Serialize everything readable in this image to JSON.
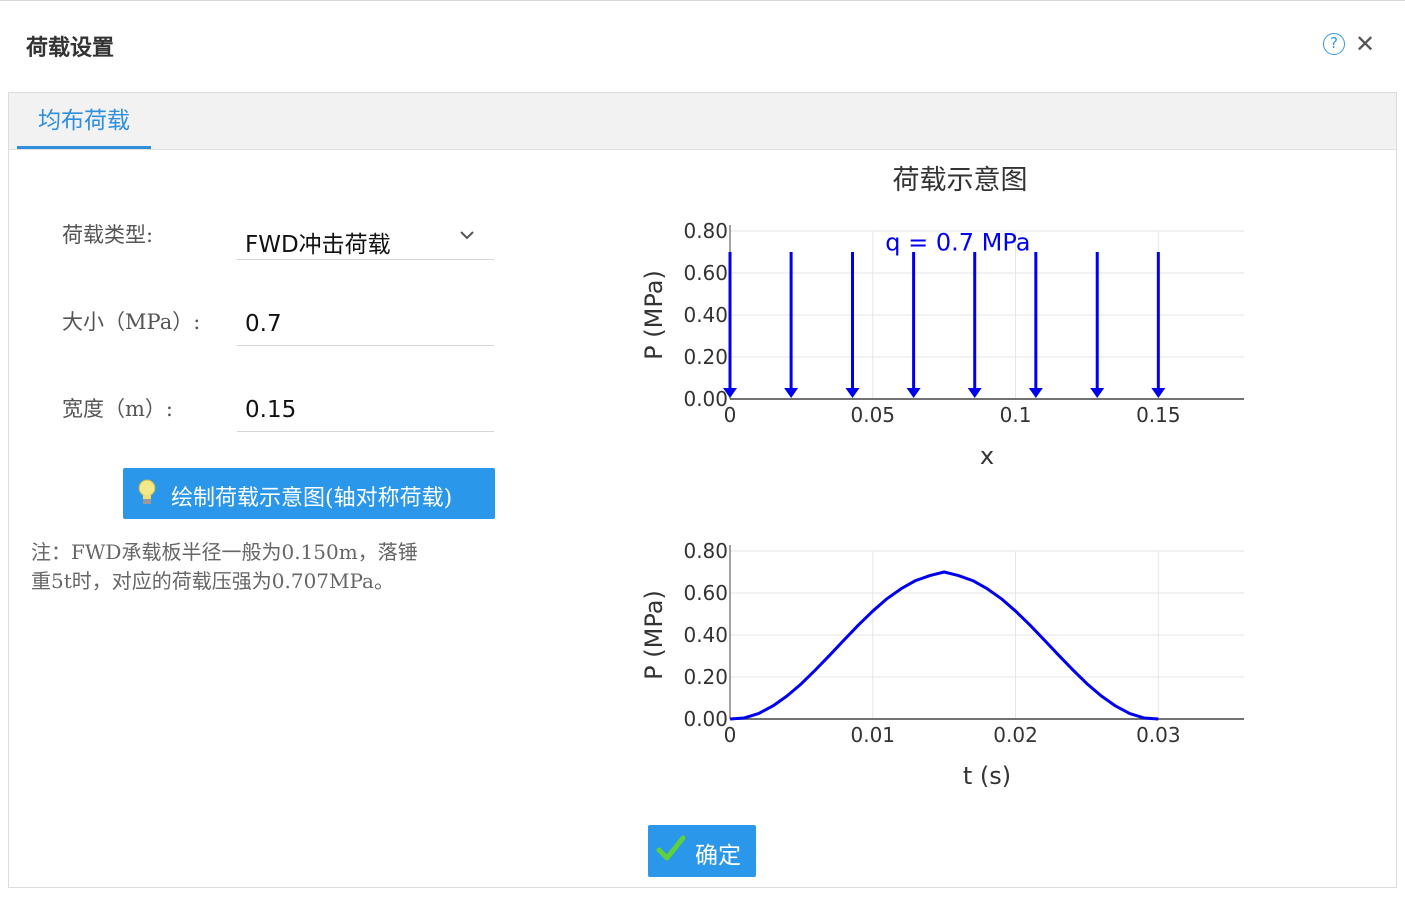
{
  "dialog": {
    "title": "荷载设置"
  },
  "tabs": [
    {
      "label": "均布荷载",
      "active": true
    }
  ],
  "form": {
    "load_type_label": "荷载类型:",
    "load_type_value": "FWD冲击荷载",
    "magnitude_label": "大小（MPa）:",
    "magnitude_value": "0.7",
    "width_label": "宽度（m）:",
    "width_value": "0.15"
  },
  "draw_button_label": "绘制荷载示意图(轴对称荷载)",
  "note_line1": "注：FWD承载板半径一般为0.150m，落锤",
  "note_line2": "重5t时，对应的荷载压强为0.707MPa。",
  "confirm_button_label": "确定",
  "colors": {
    "accent": "#2a97ea",
    "series": "#0000ee"
  },
  "chart_data": [
    {
      "type": "bar",
      "title": "荷载示意图",
      "annotation": "q = 0.7 MPa",
      "xlabel": "x",
      "ylabel": "P (MPa)",
      "x": [
        0,
        0.0214,
        0.0429,
        0.0643,
        0.0857,
        0.1071,
        0.1286,
        0.15
      ],
      "values": [
        0.7,
        0.7,
        0.7,
        0.7,
        0.7,
        0.7,
        0.7,
        0.7
      ],
      "xlim": [
        0,
        0.18
      ],
      "ylim": [
        0,
        0.8
      ],
      "xticks": [
        "0",
        "0.05",
        "0.1",
        "0.15"
      ],
      "yticks": [
        "0.00",
        "0.20",
        "0.40",
        "0.60",
        "0.80"
      ],
      "grid": true,
      "legend": "none"
    },
    {
      "type": "line",
      "xlabel": "t (s)",
      "ylabel": "P (MPa)",
      "x": [
        0,
        0.001,
        0.002,
        0.003,
        0.004,
        0.005,
        0.006,
        0.007,
        0.008,
        0.009,
        0.01,
        0.011,
        0.012,
        0.013,
        0.014,
        0.015,
        0.016,
        0.017,
        0.018,
        0.019,
        0.02,
        0.021,
        0.022,
        0.023,
        0.024,
        0.025,
        0.026,
        0.027,
        0.028,
        0.029,
        0.03
      ],
      "values": [
        0,
        0.005,
        0.026,
        0.062,
        0.11,
        0.168,
        0.235,
        0.305,
        0.377,
        0.448,
        0.514,
        0.573,
        0.621,
        0.659,
        0.683,
        0.7,
        0.683,
        0.659,
        0.621,
        0.573,
        0.514,
        0.448,
        0.377,
        0.305,
        0.235,
        0.168,
        0.11,
        0.062,
        0.026,
        0.005,
        0
      ],
      "xlim": [
        0,
        0.036
      ],
      "ylim": [
        0,
        0.8
      ],
      "xticks": [
        "0",
        "0.01",
        "0.02",
        "0.03"
      ],
      "yticks": [
        "0.00",
        "0.20",
        "0.40",
        "0.60",
        "0.80"
      ],
      "grid": true,
      "legend": "none"
    }
  ]
}
